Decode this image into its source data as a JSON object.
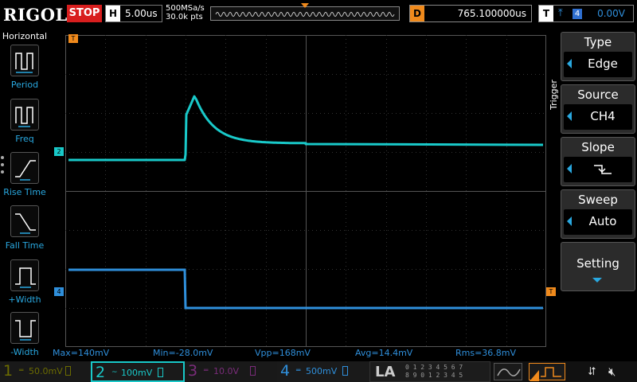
{
  "app": {
    "brand": "RIGOL",
    "run_state": "STOP"
  },
  "timebase": {
    "tag": "H",
    "scale": "5.00us",
    "sample_rate": "500MSa/s",
    "mem_depth": "30.0k pts"
  },
  "delay": {
    "tag": "D",
    "value": "765.100000us"
  },
  "trigger_status": {
    "tag": "T",
    "slope_icon": "rising-edge-icon",
    "source_num": "4",
    "level": "0.00V"
  },
  "left_menu": {
    "title": "Horizontal",
    "items": [
      {
        "label": "Period",
        "icon": "period-icon"
      },
      {
        "label": "Freq",
        "icon": "freq-icon"
      },
      {
        "label": "Rise Time",
        "icon": "rise-time-icon"
      },
      {
        "label": "Fall Time",
        "icon": "fall-time-icon"
      },
      {
        "label": "+Width",
        "icon": "pos-width-icon"
      },
      {
        "label": "-Width",
        "icon": "neg-width-icon"
      }
    ]
  },
  "right_menu": {
    "tab_label": "Trigger",
    "type": {
      "label": "Type",
      "value": "Edge"
    },
    "source": {
      "label": "Source",
      "value": "CH4"
    },
    "slope": {
      "label": "Slope",
      "value_icon": "falling-edge-icon"
    },
    "sweep": {
      "label": "Sweep",
      "value": "Auto"
    },
    "setting": {
      "label": "Setting"
    }
  },
  "markers": {
    "trigger_pos": "T",
    "ch2": "2",
    "ch4": "4",
    "trigger_level": "T"
  },
  "measurements": {
    "max": "Max=140mV",
    "min": "Min=-28.0mV",
    "vpp": "Vpp=168mV",
    "avg": "Avg=14.4mV",
    "rms": "Rms=36.8mV"
  },
  "channels": [
    {
      "num": "1",
      "coupling": "═",
      "scale": "50.0mV",
      "color": "#6c6c00"
    },
    {
      "num": "2",
      "coupling": "~",
      "scale": "100mV",
      "color": "#19c9c9"
    },
    {
      "num": "3",
      "coupling": "═",
      "scale": "10.0V",
      "color": "#7a2c7a"
    },
    {
      "num": "4",
      "coupling": "═",
      "scale": "500mV",
      "color": "#2f8fdb"
    }
  ],
  "la": {
    "label": "LA",
    "bits_row1": "0 1 2 3  4 5 6 7",
    "bits_row2": "8 9 0 1  2 3 4 5"
  },
  "colors": {
    "ch2": "#19c9c9",
    "ch4": "#2f8fdb",
    "trigger": "#f08a1c",
    "stop": "#d81e1e",
    "menu_accent": "#29a8e0"
  }
}
